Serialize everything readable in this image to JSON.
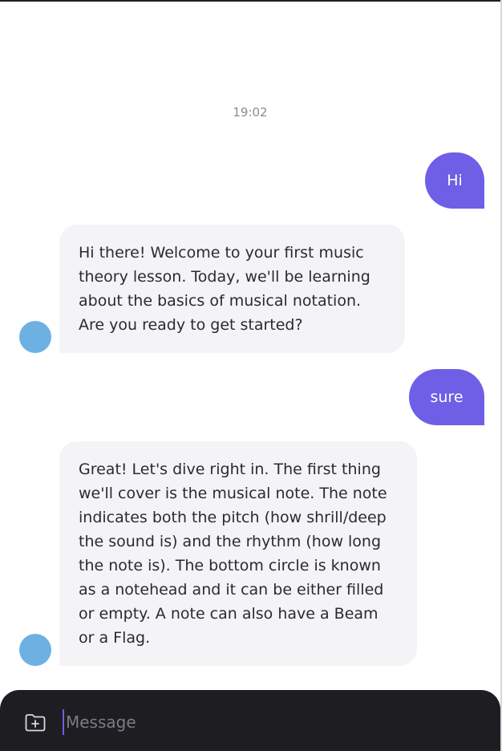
{
  "chat": {
    "timestamp": "19:02",
    "messages": [
      {
        "role": "user",
        "text": "Hi"
      },
      {
        "role": "assistant",
        "text": "Hi there! Welcome to your first music theory lesson. Today, we'll be learning about the basics of musical notation. Are you ready to get started?"
      },
      {
        "role": "user",
        "text": "sure"
      },
      {
        "role": "assistant",
        "text": "Great! Let's dive right in. The first thing we'll cover is the musical note. The note indicates both the pitch (how shrill/deep the sound is) and the rhythm (how long the note is). The bottom circle is known as a notehead and it can be either filled or empty. A note can also have a Beam or a Flag."
      }
    ]
  },
  "composer": {
    "placeholder": "Message",
    "value": ""
  },
  "icons": {
    "attach": "folder-plus-icon"
  },
  "colors": {
    "user_bubble": "#6f5ee6",
    "bot_bubble": "#f4f4f6",
    "avatar": "#6db1e3",
    "composer_bg": "#1d1d22"
  }
}
